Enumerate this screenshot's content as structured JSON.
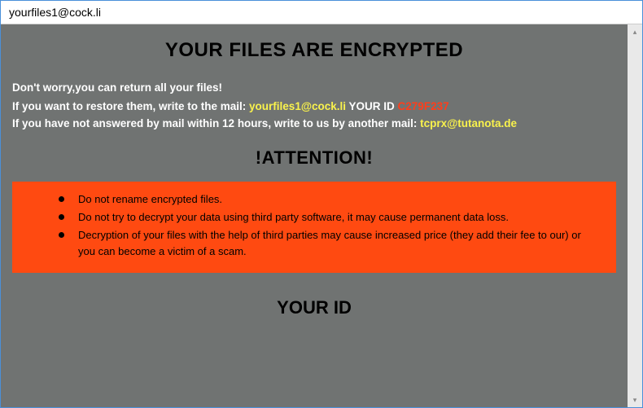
{
  "window": {
    "title": "yourfiles1@cock.li"
  },
  "main": {
    "heading": "YOUR FILES ARE ENCRYPTED",
    "line1": "Don't worry,you can return all your files!",
    "line2_prefix": "If you want to restore them, write to the mail:  ",
    "email1": "yourfiles1@cock.li",
    "your_id_label": "  YOUR ID ",
    "your_id_value": "C279F237",
    "line3_prefix": "If you have not answered by mail within 12 hours, write to us by another mail: ",
    "email2": "tcprx@tutanota.de",
    "attention": "!ATTENTION!",
    "bullets": [
      "Do not rename encrypted files.",
      "Do not try to decrypt your data using third party software, it may cause permanent data loss.",
      "Decryption of your files with the help of third parties may cause increased price (they add their fee to our) or you can become a victim of a scam."
    ],
    "your_id_heading": "YOUR ID"
  },
  "scrollbar": {
    "up": "▴",
    "down": "▾"
  }
}
